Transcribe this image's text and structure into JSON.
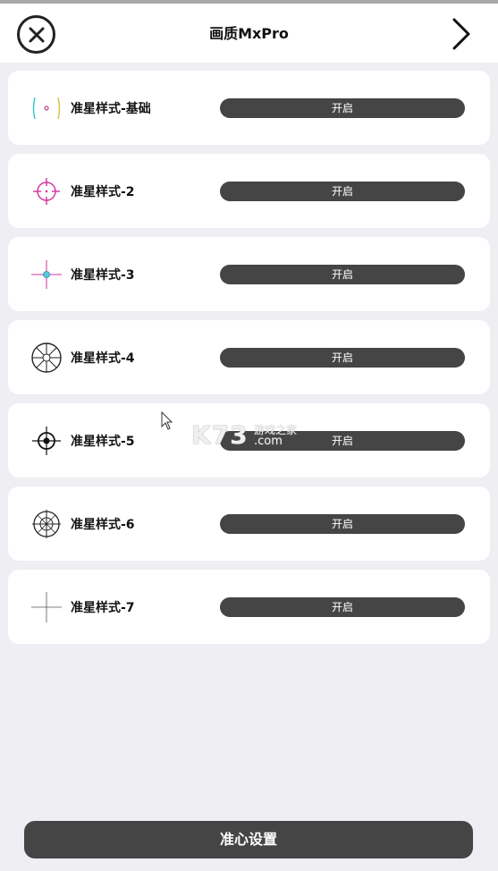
{
  "header": {
    "title": "画质MxPro",
    "close_icon": "close-circle-icon",
    "next_icon": "chevron-right-icon"
  },
  "crosshairs": [
    {
      "label": "准星样式-基础",
      "button": "开启",
      "icon": "crosshair-basic-icon"
    },
    {
      "label": "准星样式-2",
      "button": "开启",
      "icon": "crosshair-2-icon"
    },
    {
      "label": "准星样式-3",
      "button": "开启",
      "icon": "crosshair-3-icon"
    },
    {
      "label": "准星样式-4",
      "button": "开启",
      "icon": "crosshair-4-icon"
    },
    {
      "label": "准星样式-5",
      "button": "开启",
      "icon": "crosshair-5-icon"
    },
    {
      "label": "准星样式-6",
      "button": "开启",
      "icon": "crosshair-6-icon"
    },
    {
      "label": "准星样式-7",
      "button": "开启",
      "icon": "crosshair-7-icon"
    }
  ],
  "watermark": {
    "brand": "K73",
    "line1": "游戏之家",
    "line2": ".com"
  },
  "footer": {
    "button": "准心设置"
  },
  "colors": {
    "button_bg": "#454545",
    "page_bg": "#eeeef3",
    "card_bg": "#ffffff"
  }
}
